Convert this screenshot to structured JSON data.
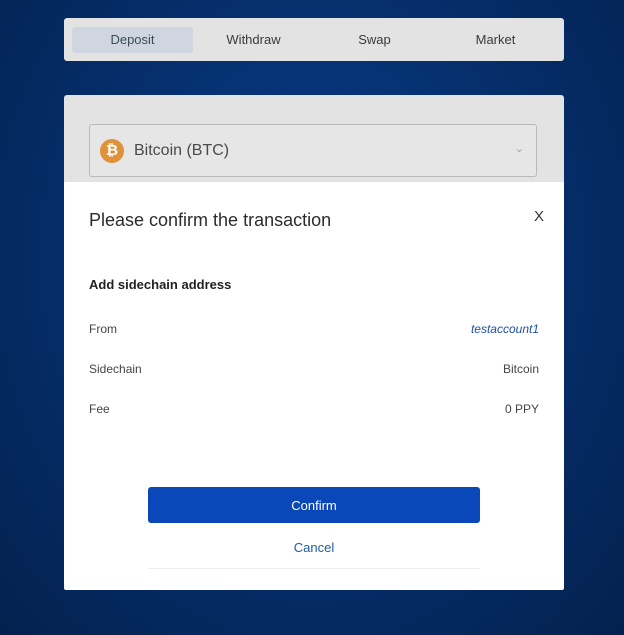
{
  "tabs": [
    "Deposit",
    "Withdraw",
    "Swap",
    "Market"
  ],
  "active_tab": "Deposit",
  "asset_select": {
    "label": "Bitcoin (BTC)",
    "icon": "bitcoin-icon",
    "icon_glyph": "₿",
    "icon_color": "#e1913a"
  },
  "modal": {
    "title": "Please confirm the transaction",
    "close_label": "X",
    "section_title": "Add sidechain address",
    "rows": [
      {
        "label": "From",
        "value": "testaccount1"
      },
      {
        "label": "Sidechain",
        "value": "Bitcoin"
      },
      {
        "label": "Fee",
        "value": "0 PPY"
      }
    ],
    "confirm_label": "Confirm",
    "cancel_label": "Cancel"
  },
  "colors": {
    "primary": "#0a47b8",
    "link": "#1f4fa8",
    "background": "#06306f"
  }
}
